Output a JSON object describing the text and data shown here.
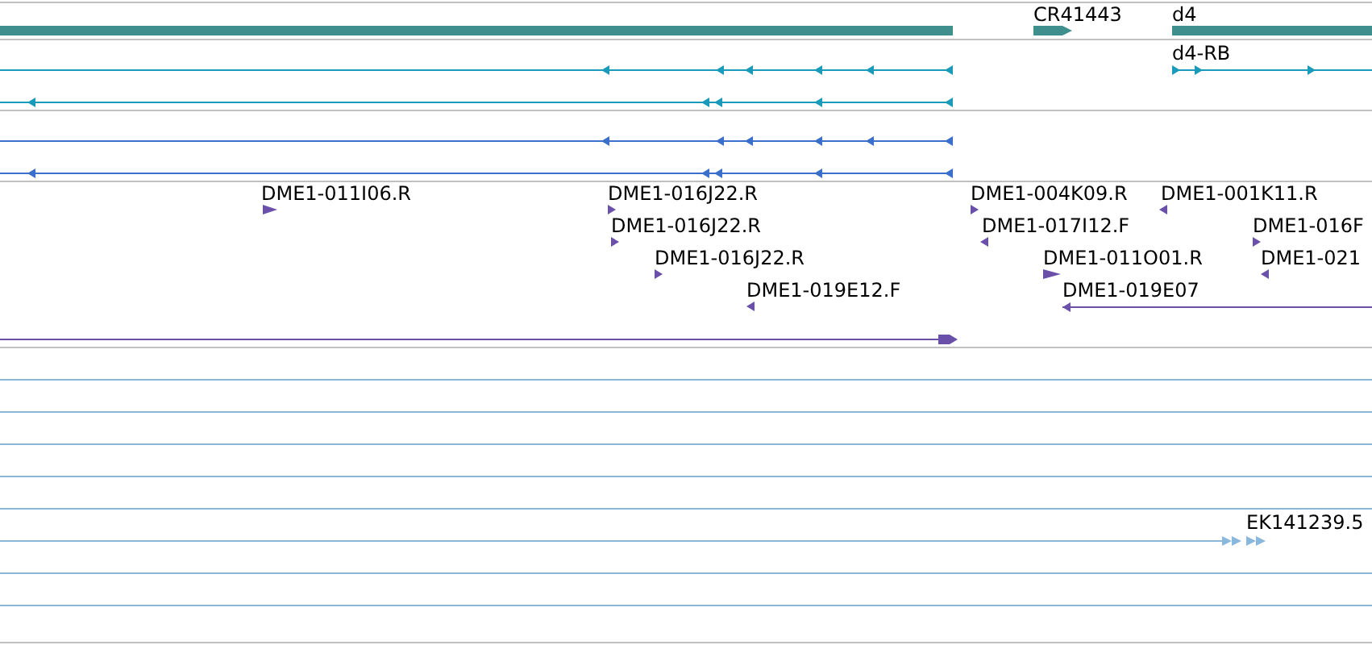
{
  "gene_track": {
    "labels": [
      "CR41443",
      "d4"
    ]
  },
  "transcript_track": {
    "labels": [
      "d4-RB"
    ]
  },
  "clone_track": {
    "labels": [
      "DME1-011I06.R",
      "DME1-016J22.R",
      "DME1-016J22.R",
      "DME1-016J22.R",
      "DME1-019E12.F",
      "DME1-004K09.R",
      "DME1-001K11.R",
      "DME1-017I12.F",
      "DME1-016F",
      "DME1-011O01.R",
      "DME1-021",
      "DME1-019E07"
    ]
  },
  "est_track": {
    "labels": [
      "EK141239.5"
    ]
  }
}
